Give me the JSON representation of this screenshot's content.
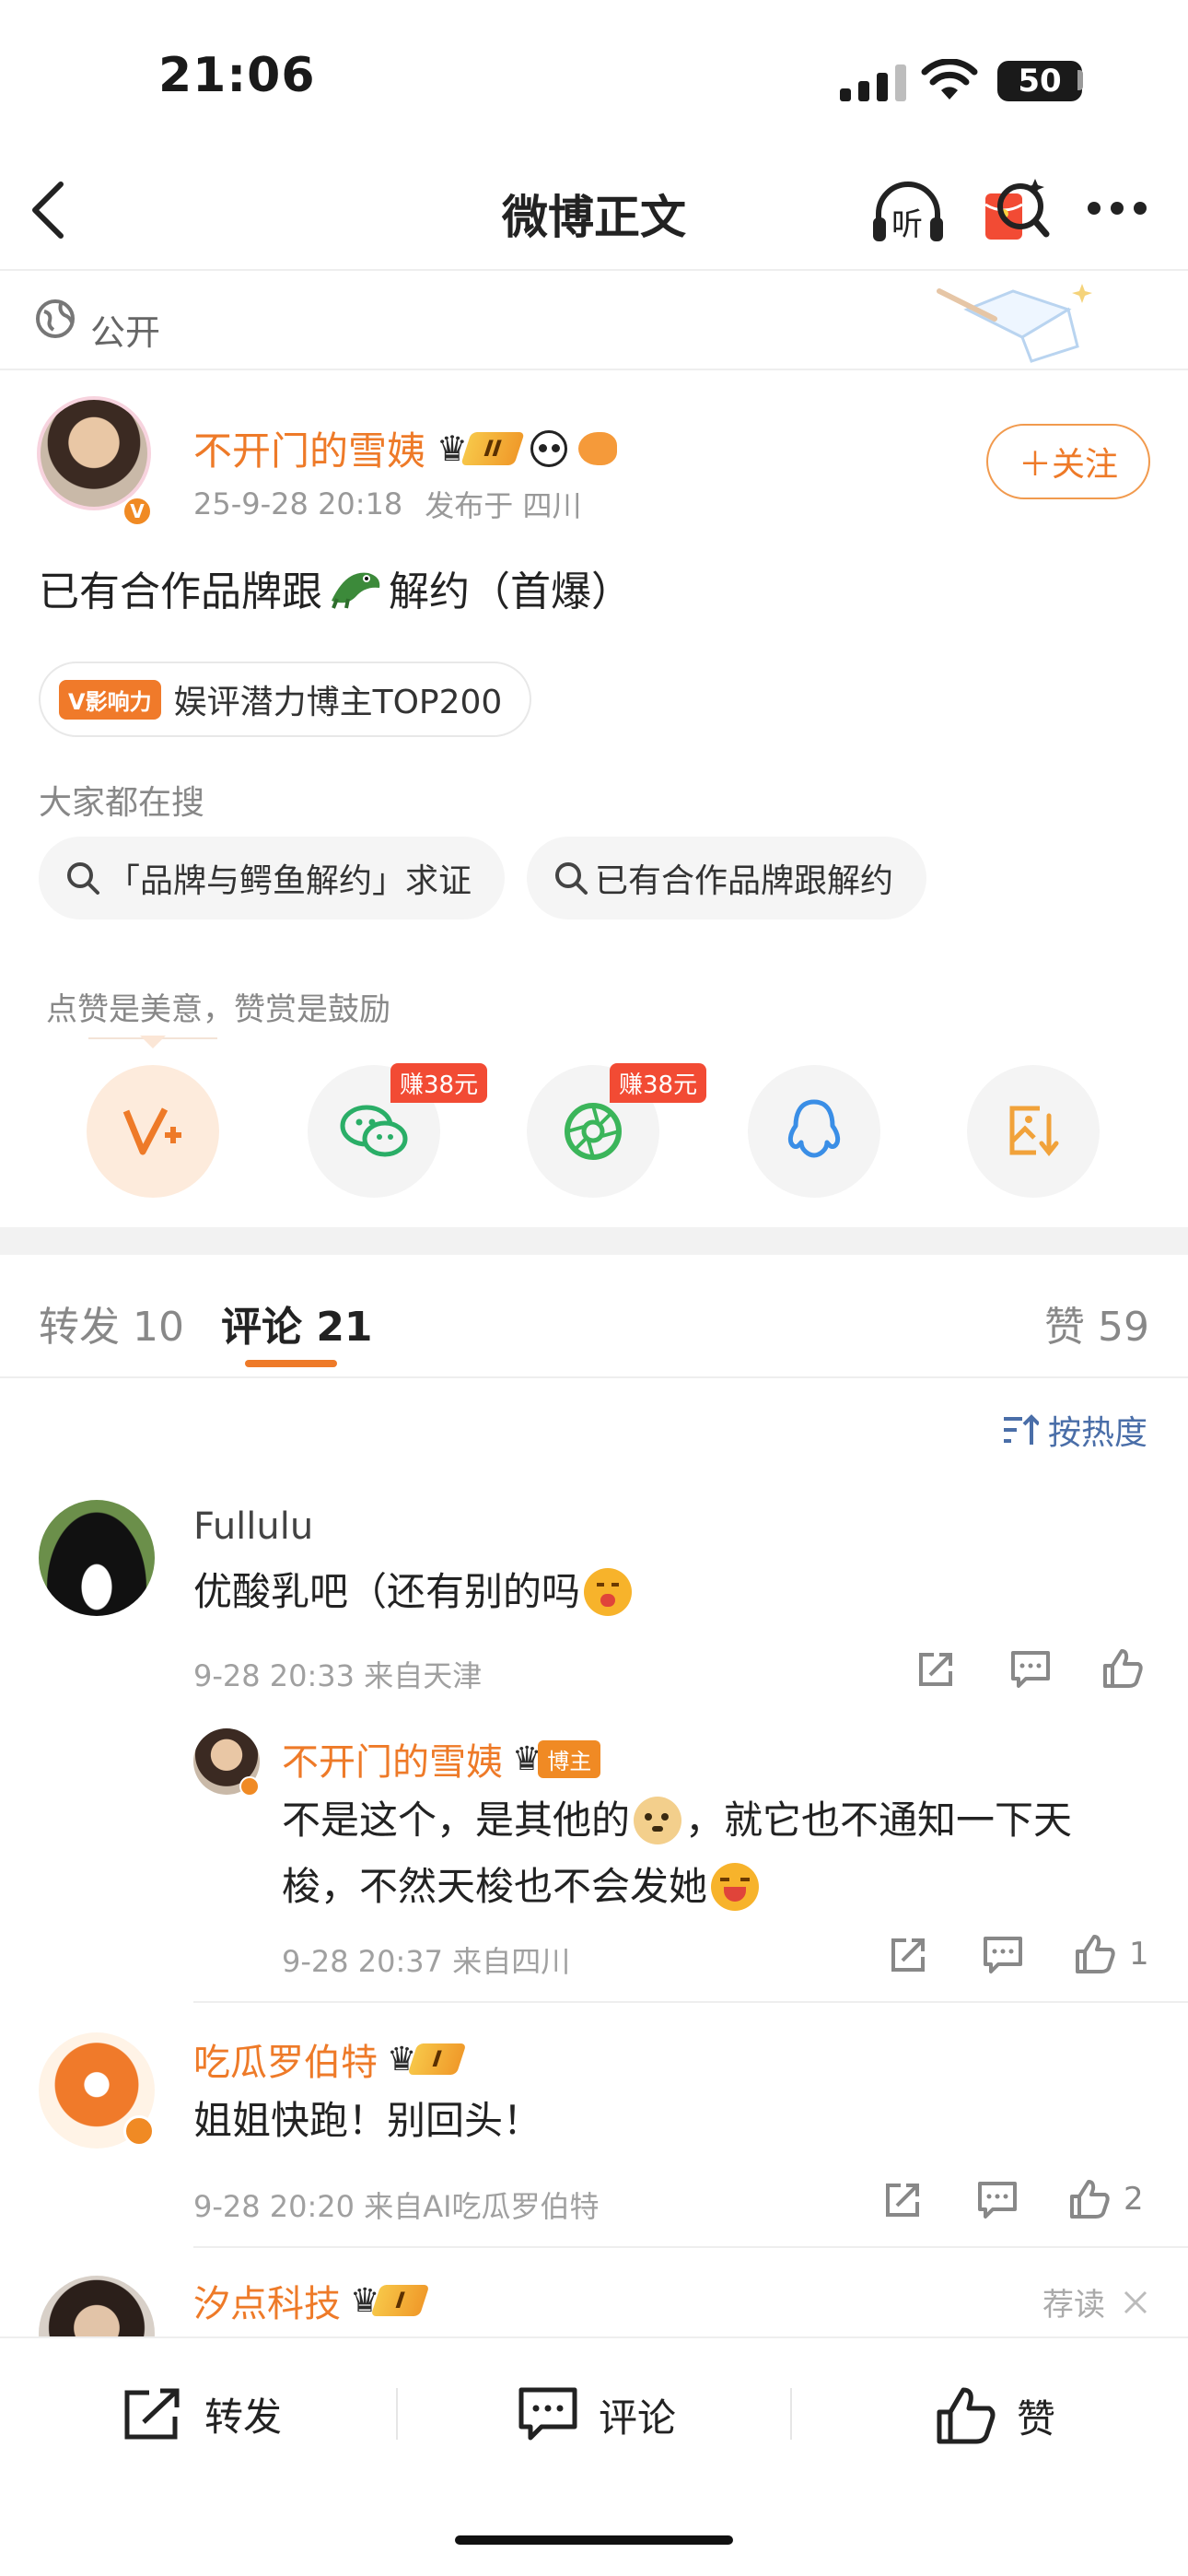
{
  "status_bar": {
    "time": "21:06",
    "battery": "50"
  },
  "nav": {
    "title": "微博正文",
    "listen_label": "听"
  },
  "visibility": {
    "label": "公开"
  },
  "post": {
    "author": "不开门的雪姨",
    "level_badge": "II",
    "timestamp": "25-9-28 20:18",
    "location": "发布于 四川",
    "follow_label": "＋关注",
    "text_before": "已有合作品牌跟",
    "text_after": "解约（首爆）",
    "influence_tag": "V影响力",
    "influence_label": "娱评潜力博主TOP200"
  },
  "trending": {
    "label": "大家都在搜",
    "items": [
      "「品牌与鳄鱼解约」求证",
      "已有合作品牌跟解约"
    ]
  },
  "reward": {
    "label": "点赞是美意，赞赏是鼓励",
    "earn_tags": [
      "赚38元",
      "赚38元"
    ]
  },
  "tabs": {
    "repost": "转发 10",
    "comments": "评论 21",
    "likes": "赞 59"
  },
  "sort_label": "按热度",
  "comments": [
    {
      "user": "Fullulu",
      "text": "优酸乳吧（还有别的吗",
      "meta": "9-28 20:33  来自天津",
      "likes": ""
    },
    {
      "user": "吃瓜罗伯特",
      "badge": "I",
      "text": "姐姐快跑！别回头！",
      "meta": "9-28 20:20  来自AI吃瓜罗伯特",
      "likes": "2"
    },
    {
      "user": "汐点科技",
      "badge": "I"
    }
  ],
  "reply": {
    "user": "不开门的雪姨",
    "role": "博主",
    "line1_before": "不是这个，是其他的",
    "line1_after": "，就它也不通知一下天",
    "line2": "梭，不然天梭也不会发她",
    "meta": "9-28 20:37  来自四川",
    "likes": "1"
  },
  "recommend_label": "荐读",
  "bottom_bar": {
    "repost": "转发",
    "comment": "评论",
    "like": "赞"
  },
  "colors": {
    "accent": "#ee7a28",
    "link": "#4a6ea8",
    "wechat": "#2aae67",
    "qq": "#3a8ee6"
  }
}
